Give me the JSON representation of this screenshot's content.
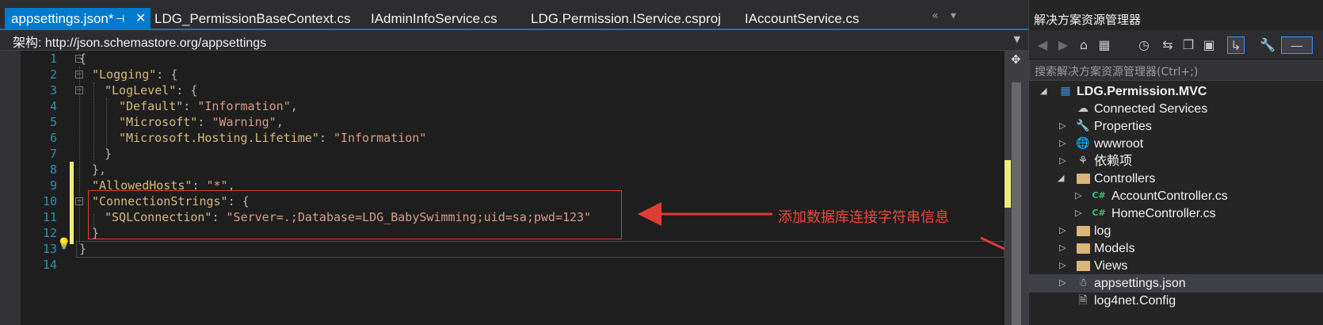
{
  "tabs": [
    {
      "label": "appsettings.json*",
      "active": true
    },
    {
      "label": "LDG_PermissionBaseContext.cs"
    },
    {
      "label": "IAdminInfoService.cs"
    },
    {
      "label": "LDG.Permission.IService.csproj"
    },
    {
      "label": "IAccountService.cs"
    }
  ],
  "tab_pin_glyph": "⊣",
  "tab_close_glyph": "✕",
  "schema": {
    "prefix": "架构:",
    "url": "http://json.schemastore.org/appsettings"
  },
  "editor": {
    "line_numbers": [
      "1",
      "2",
      "3",
      "4",
      "5",
      "6",
      "7",
      "8",
      "9",
      "10",
      "11",
      "12",
      "13",
      "14"
    ],
    "lines": {
      "l1": "{",
      "l2_key": "\"Logging\"",
      "l2_rest": ": {",
      "l3_key": "\"LogLevel\"",
      "l3_rest": ": {",
      "l4_key": "\"Default\"",
      "l4_sep": ": ",
      "l4_val": "\"Information\"",
      "l4_end": ",",
      "l5_key": "\"Microsoft\"",
      "l5_sep": ": ",
      "l5_val": "\"Warning\"",
      "l5_end": ",",
      "l6_key": "\"Microsoft.Hosting.Lifetime\"",
      "l6_sep": ": ",
      "l6_val": "\"Information\"",
      "l7": "}",
      "l8": "},",
      "l9_key": "\"AllowedHosts\"",
      "l9_sep": ": ",
      "l9_val": "\"*\"",
      "l9_end": ",",
      "l10_key": "\"ConnectionStrings\"",
      "l10_rest": ": {",
      "l11_key": "\"SQLConnection\"",
      "l11_sep": ": ",
      "l11_val": "\"Server=.;Database=LDG_BabySwimming;uid=sa;pwd=123\"",
      "l12": "}",
      "l13": "}"
    }
  },
  "annotation": {
    "text": "添加数据库连接字符串信息",
    "color": "#e03c31"
  },
  "solution_explorer": {
    "title": "解决方案资源管理器",
    "search_placeholder": "搜索解决方案资源管理器(Ctrl+;)",
    "tree": [
      {
        "label": "LDG.Permission.MVC",
        "icon": "web-project-icon"
      },
      {
        "label": "Connected Services",
        "icon": "cloud-icon"
      },
      {
        "label": "Properties",
        "icon": "wrench-icon"
      },
      {
        "label": "wwwroot",
        "icon": "globe-icon"
      },
      {
        "label": "依赖项",
        "icon": "dependencies-icon"
      },
      {
        "label": "Controllers",
        "icon": "folder-open-icon"
      },
      {
        "label": "AccountController.cs",
        "icon": "csharp-file-icon",
        "badge": "C#"
      },
      {
        "label": "HomeController.cs",
        "icon": "csharp-file-icon",
        "badge": "C#"
      },
      {
        "label": "log",
        "icon": "folder-icon"
      },
      {
        "label": "Models",
        "icon": "folder-icon"
      },
      {
        "label": "Views",
        "icon": "folder-icon"
      },
      {
        "label": "appsettings.json",
        "icon": "json-file-icon",
        "selected": true
      },
      {
        "label": "log4net.Config",
        "icon": "config-file-icon"
      }
    ]
  },
  "colors": {
    "accent": "#007acc",
    "json_key": "#d7ba7d",
    "json_string": "#d69d85",
    "line_number": "#2b91af",
    "annotation": "#e03c31"
  }
}
